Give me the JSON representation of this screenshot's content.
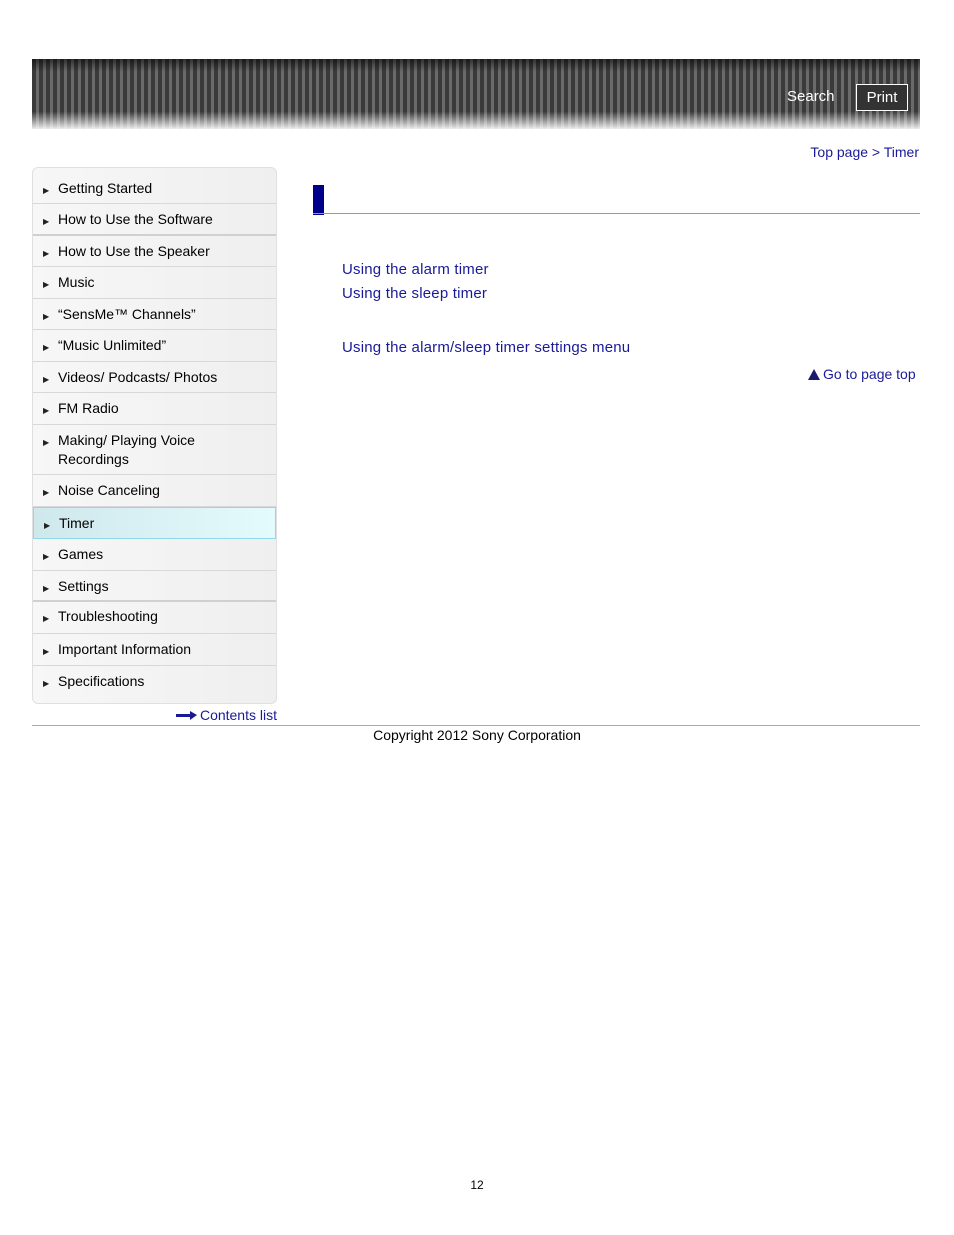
{
  "header": {
    "search_label": "Search",
    "print_label": "Print"
  },
  "breadcrumb": {
    "items": [
      "Top page",
      "Timer"
    ],
    "separator": ">"
  },
  "sidebar": {
    "items": [
      {
        "label": "Getting Started"
      },
      {
        "label": "How to Use the Software"
      },
      {
        "label": "How to Use the Speaker"
      },
      {
        "label": "Music"
      },
      {
        "label": "“SensMe™ Channels”"
      },
      {
        "label": "“Music Unlimited”"
      },
      {
        "label": "Videos/ Podcasts/ Photos"
      },
      {
        "label": "FM Radio"
      },
      {
        "label": "Making/ Playing Voice Recordings"
      },
      {
        "label": "Noise Canceling"
      },
      {
        "label": "Timer",
        "active": true
      },
      {
        "label": "Games"
      },
      {
        "label": "Settings"
      },
      {
        "label": "Troubleshooting"
      },
      {
        "label": "Important Information"
      },
      {
        "label": "Specifications"
      }
    ],
    "contents_list_label": "Contents list"
  },
  "main": {
    "title": "",
    "links": [
      "Using the alarm timer",
      "Using the sleep timer",
      "Using the alarm/sleep timer settings menu"
    ],
    "page_top_label": "Go to page top"
  },
  "footer": {
    "copyright": "Copyright 2012 Sony Corporation",
    "page_number": "12"
  }
}
